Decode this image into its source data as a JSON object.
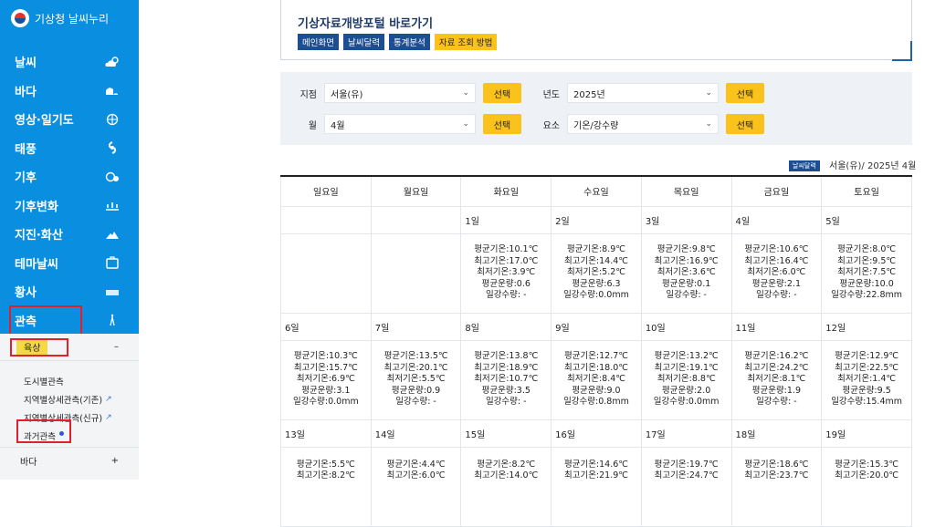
{
  "sidebar": {
    "logo_text": "기상청 날씨누리",
    "menu": [
      {
        "label": "날씨",
        "icon": "weather-cloud-sun-icon"
      },
      {
        "label": "바다",
        "icon": "sea-wave-icon"
      },
      {
        "label": "영상·일기도",
        "icon": "satellite-globe-icon"
      },
      {
        "label": "태풍",
        "icon": "typhoon-icon"
      },
      {
        "label": "기후",
        "icon": "climate-icon"
      },
      {
        "label": "기후변화",
        "icon": "climate-change-icon"
      },
      {
        "label": "지진·화산",
        "icon": "earthquake-volcano-icon"
      },
      {
        "label": "테마날씨",
        "icon": "theme-weather-icon"
      },
      {
        "label": "황사",
        "icon": "yellow-dust-icon"
      },
      {
        "label": "관측",
        "icon": "observation-tower-icon"
      }
    ],
    "sub_head": {
      "label": "육상",
      "toggle": "–"
    },
    "sub_items": [
      {
        "label": "도시별관측",
        "external": false
      },
      {
        "label": "지역별상세관측(기존)",
        "external": true
      },
      {
        "label": "지역별상세관측(신규)",
        "external": true
      },
      {
        "label": "과거관측",
        "external": false
      }
    ],
    "sub_foot": {
      "label": "바다",
      "toggle": "+"
    }
  },
  "portal": {
    "title": "기상자료개방포털 바로가기",
    "buttons": [
      "메인화면",
      "날씨달력",
      "통계분석",
      "자료 조회 방법"
    ]
  },
  "filters": {
    "station": {
      "label": "지점",
      "value": "서울(유)"
    },
    "year": {
      "label": "년도",
      "value": "2025년"
    },
    "month": {
      "label": "월",
      "value": "4월"
    },
    "element": {
      "label": "요소",
      "value": "기온/강수량"
    },
    "select_label": "선택"
  },
  "calendar": {
    "tag": "날씨달력",
    "caption": "서울(유)/ 2025년 4월",
    "weekdays": [
      "일요일",
      "월요일",
      "화요일",
      "수요일",
      "목요일",
      "금요일",
      "토요일"
    ],
    "weeks": [
      [
        {
          "day": "",
          "lines": []
        },
        {
          "day": "",
          "lines": []
        },
        {
          "day": "1일",
          "lines": [
            "평균기온:10.1℃",
            "최고기온:17.0℃",
            "최저기온:3.9℃",
            "평균운량:0.6",
            "일강수량: -"
          ]
        },
        {
          "day": "2일",
          "lines": [
            "평균기온:8.9℃",
            "최고기온:14.4℃",
            "최저기온:5.2℃",
            "평균운량:6.3",
            "일강수량:0.0mm"
          ]
        },
        {
          "day": "3일",
          "lines": [
            "평균기온:9.8℃",
            "최고기온:16.9℃",
            "최저기온:3.6℃",
            "평균운량:0.1",
            "일강수량: -"
          ]
        },
        {
          "day": "4일",
          "lines": [
            "평균기온:10.6℃",
            "최고기온:16.4℃",
            "최저기온:6.0℃",
            "평균운량:2.1",
            "일강수량: -"
          ]
        },
        {
          "day": "5일",
          "lines": [
            "평균기온:8.0℃",
            "최고기온:9.5℃",
            "최저기온:7.5℃",
            "평균운량:10.0",
            "일강수량:22.8mm"
          ]
        }
      ],
      [
        {
          "day": "6일",
          "lines": [
            "평균기온:10.3℃",
            "최고기온:15.7℃",
            "최저기온:6.9℃",
            "평균운량:3.1",
            "일강수량:0.0mm"
          ]
        },
        {
          "day": "7일",
          "lines": [
            "평균기온:13.5℃",
            "최고기온:20.1℃",
            "최저기온:5.5℃",
            "평균운량:0.9",
            "일강수량: -"
          ]
        },
        {
          "day": "8일",
          "lines": [
            "평균기온:13.8℃",
            "최고기온:18.9℃",
            "최저기온:10.7℃",
            "평균운량:3.5",
            "일강수량: -"
          ]
        },
        {
          "day": "9일",
          "lines": [
            "평균기온:12.7℃",
            "최고기온:18.0℃",
            "최저기온:8.4℃",
            "평균운량:9.0",
            "일강수량:0.8mm"
          ]
        },
        {
          "day": "10일",
          "lines": [
            "평균기온:13.2℃",
            "최고기온:19.1℃",
            "최저기온:8.8℃",
            "평균운량:2.0",
            "일강수량:0.0mm"
          ]
        },
        {
          "day": "11일",
          "lines": [
            "평균기온:16.2℃",
            "최고기온:24.2℃",
            "최저기온:8.1℃",
            "평균운량:1.9",
            "일강수량: -"
          ]
        },
        {
          "day": "12일",
          "lines": [
            "평균기온:12.9℃",
            "최고기온:22.5℃",
            "최저기온:1.4℃",
            "평균운량:9.5",
            "일강수량:15.4mm"
          ]
        }
      ],
      [
        {
          "day": "13일",
          "lines": [
            "평균기온:5.5℃",
            "최고기온:8.2℃"
          ]
        },
        {
          "day": "14일",
          "lines": [
            "평균기온:4.4℃",
            "최고기온:6.0℃"
          ]
        },
        {
          "day": "15일",
          "lines": [
            "평균기온:8.2℃",
            "최고기온:14.0℃"
          ]
        },
        {
          "day": "16일",
          "lines": [
            "평균기온:14.6℃",
            "최고기온:21.9℃"
          ]
        },
        {
          "day": "17일",
          "lines": [
            "평균기온:19.7℃",
            "최고기온:24.7℃"
          ]
        },
        {
          "day": "18일",
          "lines": [
            "평균기온:18.6℃",
            "최고기온:23.7℃"
          ]
        },
        {
          "day": "19일",
          "lines": [
            "평균기온:15.3℃",
            "최고기온:20.0℃"
          ]
        }
      ]
    ]
  }
}
